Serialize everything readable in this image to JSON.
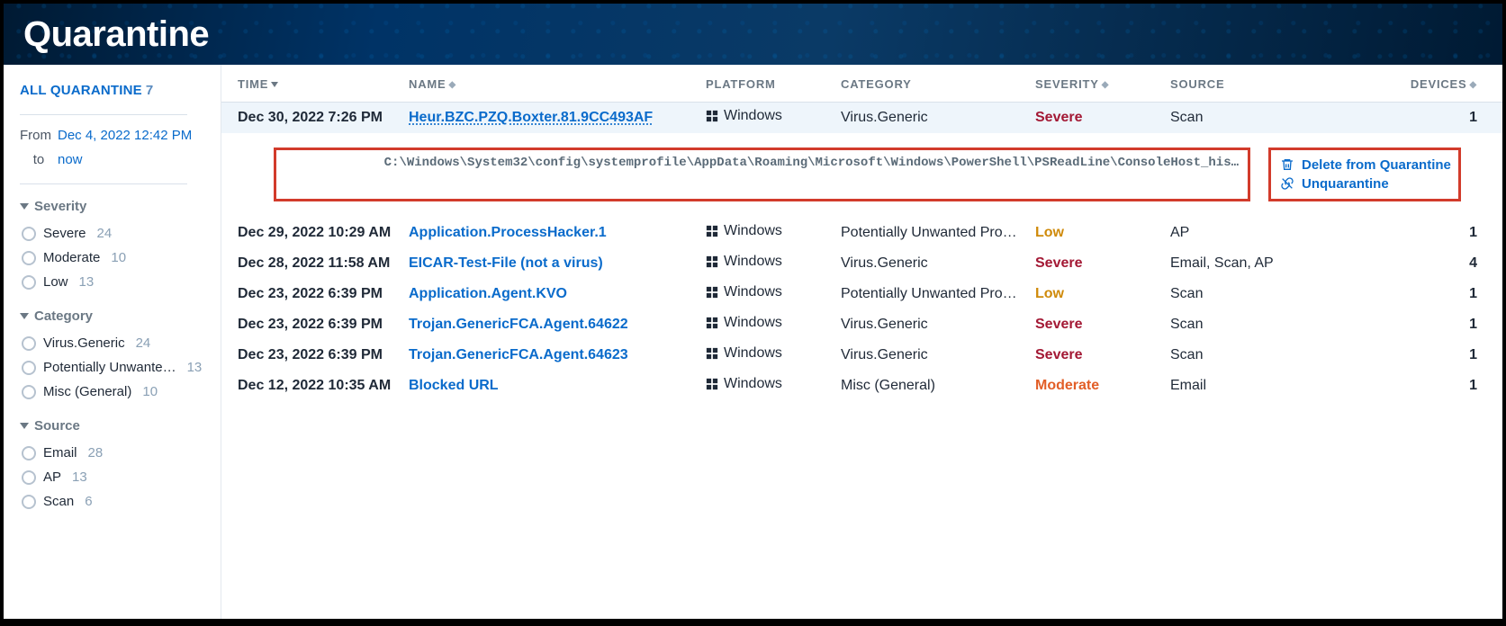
{
  "page_title": "Quarantine",
  "sidebar": {
    "all_label": "ALL QUARANTINE",
    "all_count": "7",
    "from_label": "From",
    "from_value": "Dec 4, 2022 12:42 PM",
    "to_label": "to",
    "to_value": "now",
    "groups": [
      {
        "title": "Severity",
        "items": [
          {
            "name": "Severe",
            "count": "24"
          },
          {
            "name": "Moderate",
            "count": "10"
          },
          {
            "name": "Low",
            "count": "13"
          }
        ]
      },
      {
        "title": "Category",
        "items": [
          {
            "name": "Virus.Generic",
            "count": "24"
          },
          {
            "name": "Potentially Unwante…",
            "count": "13"
          },
          {
            "name": "Misc (General)",
            "count": "10"
          }
        ]
      },
      {
        "title": "Source",
        "items": [
          {
            "name": "Email",
            "count": "28"
          },
          {
            "name": "AP",
            "count": "13"
          },
          {
            "name": "Scan",
            "count": "6"
          }
        ]
      }
    ]
  },
  "columns": {
    "time": "TIME",
    "name": "NAME",
    "platform": "PLATFORM",
    "category": "CATEGORY",
    "severity": "SEVERITY",
    "source": "SOURCE",
    "devices": "DEVICES"
  },
  "platform_label": "Windows",
  "rows": [
    {
      "time": "Dec 30, 2022 7:26 PM",
      "name": "Heur.BZC.PZQ.Boxter.81.9CC493AF",
      "category": "Virus.Generic",
      "severity": "Severe",
      "source": "Scan",
      "devices": "1",
      "expanded": true,
      "path": "C:\\Windows\\System32\\config\\systemprofile\\AppData\\Roaming\\Microsoft\\Windows\\PowerShell\\PSReadLine\\ConsoleHost_his…",
      "action_delete": "Delete from Quarantine",
      "action_unq": "Unquarantine"
    },
    {
      "time": "Dec 29, 2022 10:29 AM",
      "name": "Application.ProcessHacker.1",
      "category": "Potentially Unwanted Prog…",
      "severity": "Low",
      "source": "AP",
      "devices": "1"
    },
    {
      "time": "Dec 28, 2022 11:58 AM",
      "name": "EICAR-Test-File (not a virus)",
      "category": "Virus.Generic",
      "severity": "Severe",
      "source": "Email, Scan, AP",
      "devices": "4"
    },
    {
      "time": "Dec 23, 2022 6:39 PM",
      "name": "Application.Agent.KVO",
      "category": "Potentially Unwanted Prog…",
      "severity": "Low",
      "source": "Scan",
      "devices": "1"
    },
    {
      "time": "Dec 23, 2022 6:39 PM",
      "name": "Trojan.GenericFCA.Agent.64622",
      "category": "Virus.Generic",
      "severity": "Severe",
      "source": "Scan",
      "devices": "1"
    },
    {
      "time": "Dec 23, 2022 6:39 PM",
      "name": "Trojan.GenericFCA.Agent.64623",
      "category": "Virus.Generic",
      "severity": "Severe",
      "source": "Scan",
      "devices": "1"
    },
    {
      "time": "Dec 12, 2022 10:35 AM",
      "name": "Blocked URL",
      "category": "Misc (General)",
      "severity": "Moderate",
      "source": "Email",
      "devices": "1"
    }
  ]
}
